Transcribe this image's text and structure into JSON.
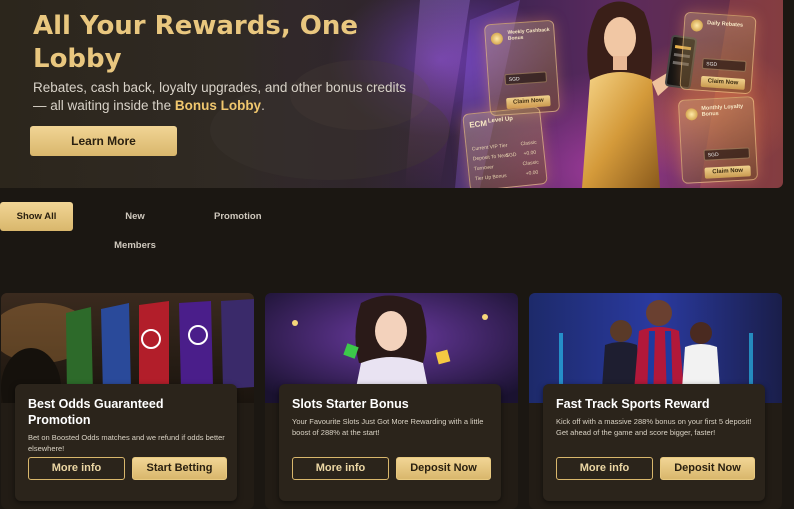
{
  "hero": {
    "title": "All Your Rewards, One Lobby",
    "subtitle_prefix": "Rebates, cash back, loyalty upgrades, and other bonus credits — all waiting inside the ",
    "subtitle_highlight": "Bonus Lobby",
    "subtitle_suffix": ".",
    "cta_label": "Learn More",
    "art": {
      "panel1_title": "Weekly Cashback Bonus",
      "panel1_input": "SGD",
      "panel1_button": "Claim Now",
      "panel2_title": "Daily Rebates",
      "panel2_input": "SGD",
      "panel2_button": "Claim Now",
      "panel3_title": "Monthly Loyalty Bonus",
      "panel3_input": "SGD",
      "panel3_button": "Claim Now",
      "panel4_logo": "ECM",
      "panel4_title": "Level Up",
      "panel4_row1": "Current VIP Tier",
      "panel4_row1_value": "Classic",
      "panel4_row2": "Deposit To Next",
      "panel4_row2_currency": "SGD",
      "panel4_row2_value": "+0.00",
      "panel4_row3": "Turnover",
      "panel4_row3_value": "Classic",
      "panel4_row4": "Tier Up Bonus",
      "panel4_row4_value": "+0.00"
    }
  },
  "tabs": [
    {
      "label": "Show All",
      "active": true
    },
    {
      "label": "New Members",
      "active": false
    },
    {
      "label": "Promotion",
      "active": false
    }
  ],
  "cards": [
    {
      "title": "Best Odds Guaranteed Promotion",
      "description": "Bet on Boosted Odds matches and we refund if odds better elsewhere!",
      "secondary_label": "More info",
      "primary_label": "Start Betting"
    },
    {
      "title": "Slots Starter Bonus",
      "description": "Your Favourite Slots Just Got More Rewarding with a little boost of 288% at the start!",
      "secondary_label": "More info",
      "primary_label": "Deposit Now"
    },
    {
      "title": "Fast Track Sports Reward",
      "description": "Kick off with a massive 288% bonus on your first 5 deposit! Get ahead of the game and score bigger, faster!",
      "secondary_label": "More info",
      "primary_label": "Deposit Now"
    }
  ],
  "colors": {
    "accent_gold": "#d9b76c",
    "title_gold": "#e9c77f",
    "background": "#1b1712"
  }
}
